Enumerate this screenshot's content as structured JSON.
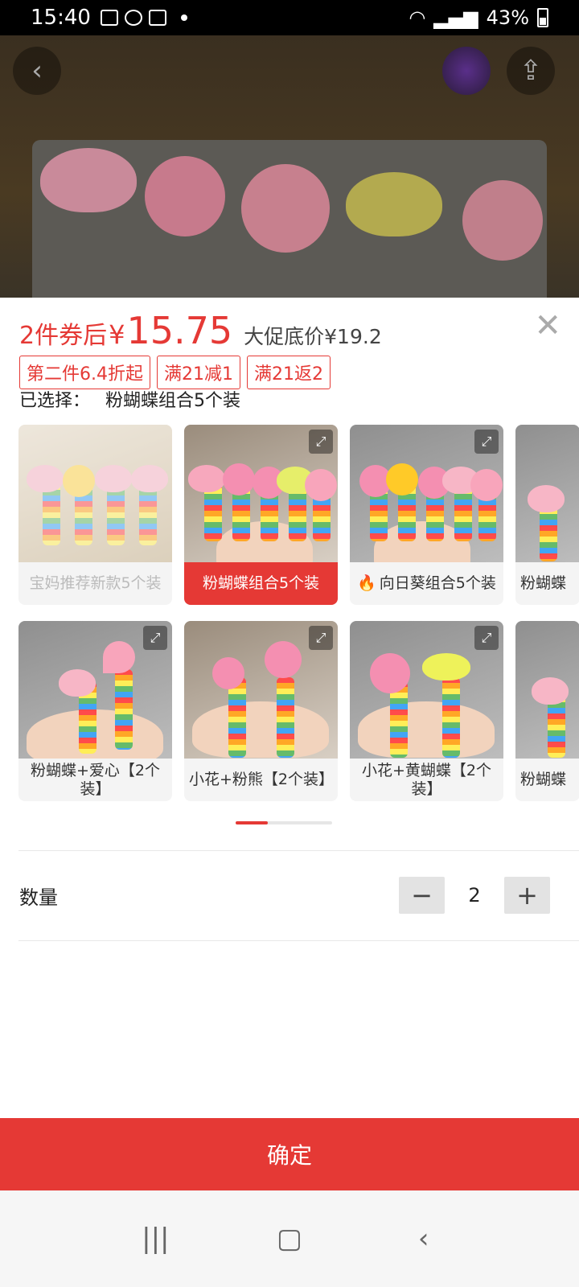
{
  "status_bar": {
    "time": "15:40",
    "battery": "43%"
  },
  "price": {
    "prefix": "2件券后",
    "currency": "¥",
    "value": "15.75",
    "original": "大促底价¥19.2"
  },
  "tags": [
    "第二件6.4折起",
    "满21减1",
    "满21返2"
  ],
  "selected": {
    "label": "已选择：",
    "value": "粉蝴蝶组合5个装"
  },
  "options_row1": [
    {
      "label": "宝妈推荐新款5个装",
      "state": "disabled"
    },
    {
      "label": "粉蝴蝶组合5个装",
      "state": "active"
    },
    {
      "label": "向日葵组合5个装",
      "state": "normal",
      "hot": true
    },
    {
      "label": "粉蝴蝶",
      "state": "partial"
    }
  ],
  "options_row2": [
    {
      "label": "粉蝴蝶+爱心【2个装】",
      "state": "normal"
    },
    {
      "label": "小花+粉熊【2个装】",
      "state": "normal"
    },
    {
      "label": "小花+黄蝴蝶【2个装】",
      "state": "normal"
    },
    {
      "label": "粉蝴蝶",
      "state": "partial"
    }
  ],
  "quantity": {
    "label": "数量",
    "minus": "−",
    "value": "2",
    "plus": "+"
  },
  "confirm_label": "确定",
  "icons": {
    "close": "close-icon",
    "expand": "expand-icon",
    "back": "back-icon",
    "share": "share-icon",
    "hot": "fire-icon"
  },
  "colors": {
    "accent": "#e53935"
  }
}
